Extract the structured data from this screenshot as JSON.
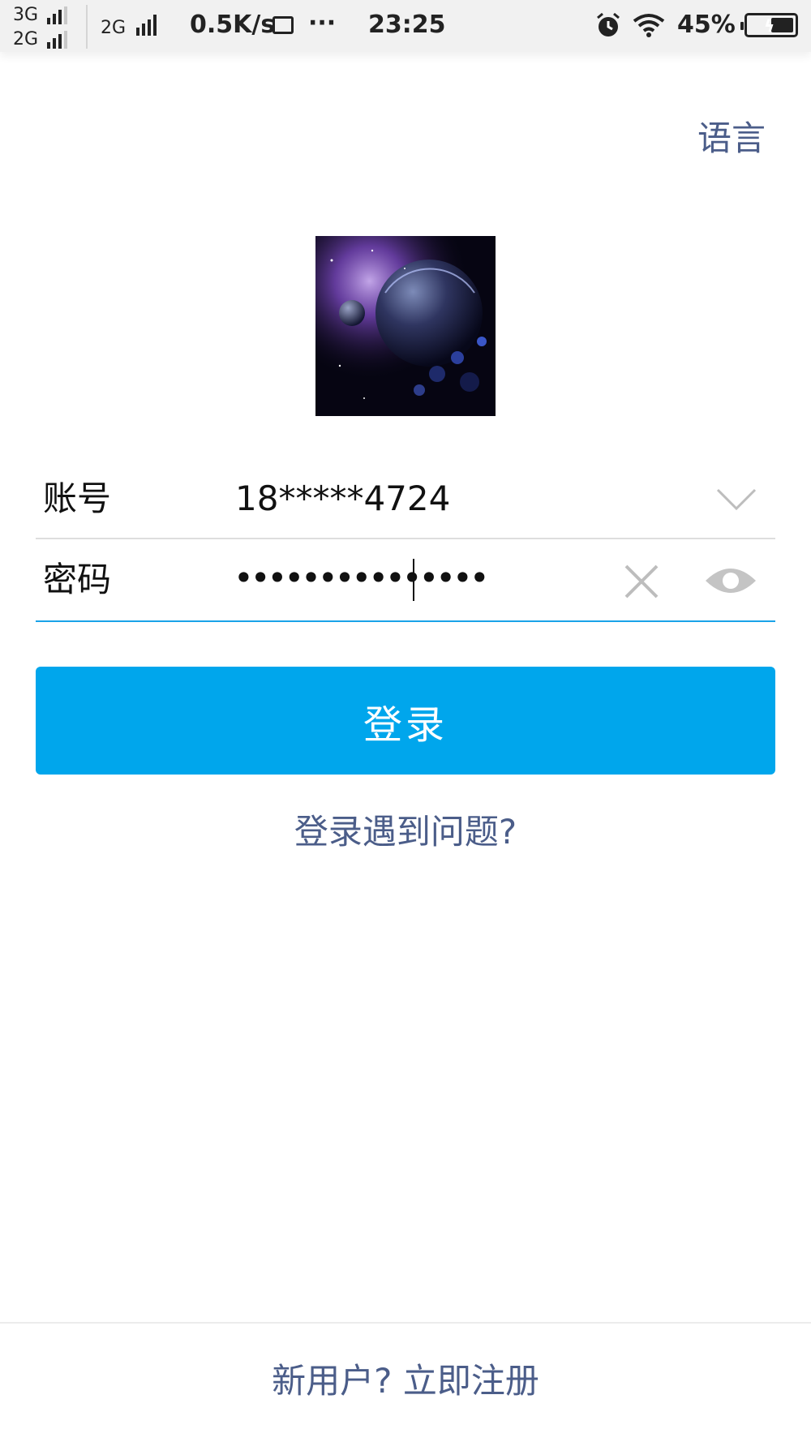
{
  "status_bar": {
    "net1_label": "3G",
    "net2_label": "2G",
    "net3_label": "2G",
    "speed": "0.5K/s",
    "more": "···",
    "time": "23:25",
    "battery": "45%"
  },
  "header": {
    "language_label": "语言"
  },
  "avatar": {
    "icon": "planet-avatar-image"
  },
  "form": {
    "account_label": "账号",
    "account_value": "18*****4724",
    "password_label": "密码",
    "password_value": "•••••••••••••••"
  },
  "actions": {
    "login_label": "登录",
    "help_label": "登录遇到问题?",
    "register_label": "新用户? 立即注册"
  },
  "colors": {
    "accent": "#00a6ec",
    "link": "#4b5d89",
    "active_underline": "#1aa3e8"
  }
}
